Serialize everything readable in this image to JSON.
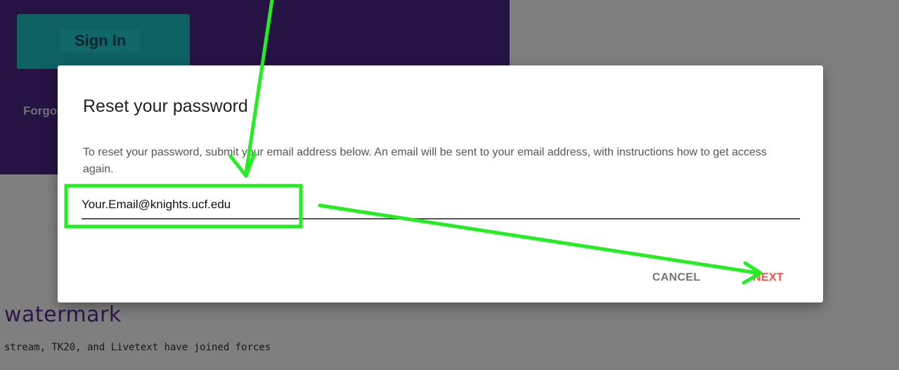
{
  "background": {
    "signin_label": "Sign In",
    "forgot_label": "Forgo",
    "brand_name": "watermark",
    "tagline_line1": "stream, TK20, and Livetext have joined forces",
    "tagline_line2": ""
  },
  "dialog": {
    "title": "Reset your password",
    "description": "To reset your password, submit your email address below. An email will be sent to your email address, with instructions how to get access again.",
    "email_value": "Your.Email@knights.ucf.edu",
    "cancel_label": "CANCEL",
    "next_label": "NEXT"
  },
  "colors": {
    "panel_purple": "#4a2787",
    "signin_teal": "#1fc3c3",
    "next_red": "#f0554d",
    "annotation_green": "#22ee22"
  }
}
